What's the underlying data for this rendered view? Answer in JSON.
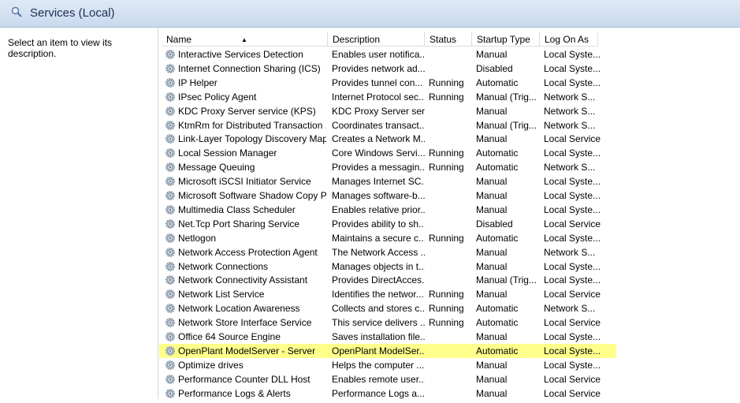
{
  "header": {
    "title": "Services (Local)",
    "icon": "magnifier-icon"
  },
  "left_pane": {
    "description_prompt": "Select an item to view its description."
  },
  "columns": [
    "Name",
    "Description",
    "Status",
    "Startup Type",
    "Log On As"
  ],
  "rows": [
    {
      "name": "Interactive Services Detection",
      "description": "Enables user notifica...",
      "status": "",
      "startup": "Manual",
      "logon": "Local Syste..."
    },
    {
      "name": "Internet Connection Sharing (ICS)",
      "description": "Provides network ad...",
      "status": "",
      "startup": "Disabled",
      "logon": "Local Syste..."
    },
    {
      "name": "IP Helper",
      "description": "Provides tunnel con...",
      "status": "Running",
      "startup": "Automatic",
      "logon": "Local Syste..."
    },
    {
      "name": "IPsec Policy Agent",
      "description": "Internet Protocol sec...",
      "status": "Running",
      "startup": "Manual (Trig...",
      "logon": "Network S..."
    },
    {
      "name": "KDC Proxy Server service (KPS)",
      "description": "KDC Proxy Server ser...",
      "status": "",
      "startup": "Manual",
      "logon": "Network S..."
    },
    {
      "name": "KtmRm for Distributed Transaction ...",
      "description": "Coordinates transact...",
      "status": "",
      "startup": "Manual (Trig...",
      "logon": "Network S..."
    },
    {
      "name": "Link-Layer Topology Discovery Map...",
      "description": "Creates a Network M...",
      "status": "",
      "startup": "Manual",
      "logon": "Local Service"
    },
    {
      "name": "Local Session Manager",
      "description": "Core Windows Servi...",
      "status": "Running",
      "startup": "Automatic",
      "logon": "Local Syste..."
    },
    {
      "name": "Message Queuing",
      "description": "Provides a messagin...",
      "status": "Running",
      "startup": "Automatic",
      "logon": "Network S..."
    },
    {
      "name": "Microsoft iSCSI Initiator Service",
      "description": "Manages Internet SC...",
      "status": "",
      "startup": "Manual",
      "logon": "Local Syste..."
    },
    {
      "name": "Microsoft Software Shadow Copy Pr...",
      "description": "Manages software-b...",
      "status": "",
      "startup": "Manual",
      "logon": "Local Syste..."
    },
    {
      "name": "Multimedia Class Scheduler",
      "description": "Enables relative prior...",
      "status": "",
      "startup": "Manual",
      "logon": "Local Syste..."
    },
    {
      "name": "Net.Tcp Port Sharing Service",
      "description": "Provides ability to sh...",
      "status": "",
      "startup": "Disabled",
      "logon": "Local Service"
    },
    {
      "name": "Netlogon",
      "description": "Maintains a secure c...",
      "status": "Running",
      "startup": "Automatic",
      "logon": "Local Syste..."
    },
    {
      "name": "Network Access Protection Agent",
      "description": "The Network Access ...",
      "status": "",
      "startup": "Manual",
      "logon": "Network S..."
    },
    {
      "name": "Network Connections",
      "description": "Manages objects in t...",
      "status": "",
      "startup": "Manual",
      "logon": "Local Syste..."
    },
    {
      "name": "Network Connectivity Assistant",
      "description": "Provides DirectAcces...",
      "status": "",
      "startup": "Manual (Trig...",
      "logon": "Local Syste..."
    },
    {
      "name": "Network List Service",
      "description": "Identifies the networ...",
      "status": "Running",
      "startup": "Manual",
      "logon": "Local Service"
    },
    {
      "name": "Network Location Awareness",
      "description": "Collects and stores c...",
      "status": "Running",
      "startup": "Automatic",
      "logon": "Network S..."
    },
    {
      "name": "Network Store Interface Service",
      "description": "This service delivers ...",
      "status": "Running",
      "startup": "Automatic",
      "logon": "Local Service"
    },
    {
      "name": "Office 64 Source Engine",
      "description": "Saves installation file...",
      "status": "",
      "startup": "Manual",
      "logon": "Local Syste..."
    },
    {
      "name": "OpenPlant ModelServer - Server",
      "description": "OpenPlant ModelSer...",
      "status": "",
      "startup": "Automatic",
      "logon": "Local Syste...",
      "highlight": true
    },
    {
      "name": "Optimize drives",
      "description": "Helps the computer ...",
      "status": "",
      "startup": "Manual",
      "logon": "Local Syste..."
    },
    {
      "name": "Performance Counter DLL Host",
      "description": "Enables remote user...",
      "status": "",
      "startup": "Manual",
      "logon": "Local Service"
    },
    {
      "name": "Performance Logs & Alerts",
      "description": "Performance Logs a...",
      "status": "",
      "startup": "Manual",
      "logon": "Local Service"
    }
  ],
  "colors": {
    "highlight": "#ffff8c",
    "header_bg": "#c9d9ee",
    "title_text": "#1e2f4f"
  }
}
